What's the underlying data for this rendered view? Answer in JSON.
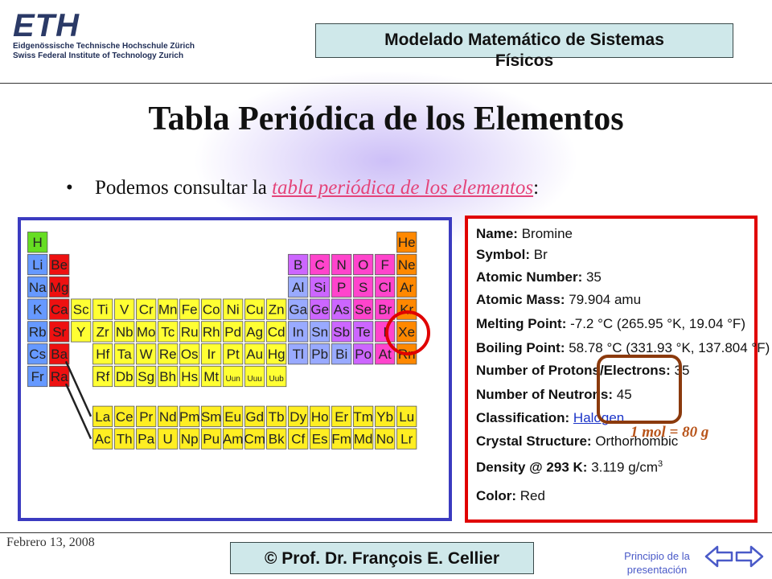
{
  "header": {
    "logo_mark": "ETH",
    "logo_line1": "Eidgenössische Technische Hochschule Zürich",
    "logo_line2": "Swiss Federal Institute of Technology Zurich",
    "course_line1": "Modelado Matemático de Sistemas",
    "course_line2": "Físicos"
  },
  "slide": {
    "title": "Tabla Periódica de los Elementos",
    "bullet_prefix": "Podemos consultar la ",
    "bullet_link": "tabla periódica de los elementos",
    "bullet_suffix": ":"
  },
  "element_info": [
    {
      "label": "Name:",
      "value": "Bromine"
    },
    {
      "label": "Symbol:",
      "value": "Br"
    },
    {
      "label": "Atomic Number:",
      "value": "35"
    },
    {
      "label": "Atomic Mass:",
      "value": "79.904 amu"
    },
    {
      "label": "Melting Point:",
      "value": "-7.2 °C (265.95 °K, 19.04 °F)"
    },
    {
      "label": "Boiling Point:",
      "value": "58.78 °C (331.93 °K, 137.804 °F)"
    },
    {
      "label": "Number of Protons/Electrons:",
      "value": "35"
    },
    {
      "label": "Number of Neutrons:",
      "value": "45"
    },
    {
      "label": "Classification:",
      "value": "Halogen"
    },
    {
      "label": "Crystal Structure:",
      "value": "Orthorhombic"
    },
    {
      "label": "Density @ 293 K:",
      "value": "3.119 g/cm"
    },
    {
      "label": "Color:",
      "value": "Red"
    }
  ],
  "density_exponent": "3",
  "annotation": "1 mol = 80 g",
  "footer": {
    "date": "Febrero 13, 2008",
    "author": "© Prof. Dr. François E. Cellier",
    "start_line1": "Principio de la",
    "start_line2": "presentación"
  },
  "periodic_table": {
    "colors": {
      "h": "#66dd22",
      "alkali": "#6699ff",
      "alkaline": "#ee1111",
      "transition": "#ffff33",
      "metal": "#99aaff",
      "metalloid": "#cc66ff",
      "nonmetal": "#ff44cc",
      "halogen": "#ff44cc",
      "noble": "#ff8800",
      "lanth": "#ffee22",
      "unknown": "#ffff33"
    },
    "rows": [
      [
        [
          "H",
          "h",
          0
        ],
        [
          "He",
          "noble",
          17
        ]
      ],
      [
        [
          "Li",
          "alkali",
          0
        ],
        [
          "Be",
          "alkaline",
          1
        ],
        [
          "B",
          "metalloid",
          12
        ],
        [
          "C",
          "nonmetal",
          13
        ],
        [
          "N",
          "nonmetal",
          14
        ],
        [
          "O",
          "nonmetal",
          15
        ],
        [
          "F",
          "halogen",
          16
        ],
        [
          "Ne",
          "noble",
          17
        ]
      ],
      [
        [
          "Na",
          "alkali",
          0
        ],
        [
          "Mg",
          "alkaline",
          1
        ],
        [
          "Al",
          "metal",
          12
        ],
        [
          "Si",
          "metalloid",
          13
        ],
        [
          "P",
          "nonmetal",
          14
        ],
        [
          "S",
          "nonmetal",
          15
        ],
        [
          "Cl",
          "halogen",
          16
        ],
        [
          "Ar",
          "noble",
          17
        ]
      ],
      [
        [
          "K",
          "alkali",
          0
        ],
        [
          "Ca",
          "alkaline",
          1
        ],
        [
          "Sc",
          "transition",
          2
        ],
        [
          "Ti",
          "transition",
          3
        ],
        [
          "V",
          "transition",
          4
        ],
        [
          "Cr",
          "transition",
          5
        ],
        [
          "Mn",
          "transition",
          6
        ],
        [
          "Fe",
          "transition",
          7
        ],
        [
          "Co",
          "transition",
          8
        ],
        [
          "Ni",
          "transition",
          9
        ],
        [
          "Cu",
          "transition",
          10
        ],
        [
          "Zn",
          "transition",
          11
        ],
        [
          "Ga",
          "metal",
          12
        ],
        [
          "Ge",
          "metalloid",
          13
        ],
        [
          "As",
          "metalloid",
          14
        ],
        [
          "Se",
          "nonmetal",
          15
        ],
        [
          "Br",
          "halogen",
          16
        ],
        [
          "Kr",
          "noble",
          17
        ]
      ],
      [
        [
          "Rb",
          "alkali",
          0
        ],
        [
          "Sr",
          "alkaline",
          1
        ],
        [
          "Y",
          "transition",
          2
        ],
        [
          "Zr",
          "transition",
          3
        ],
        [
          "Nb",
          "transition",
          4
        ],
        [
          "Mo",
          "transition",
          5
        ],
        [
          "Tc",
          "transition",
          6
        ],
        [
          "Ru",
          "transition",
          7
        ],
        [
          "Rh",
          "transition",
          8
        ],
        [
          "Pd",
          "transition",
          9
        ],
        [
          "Ag",
          "transition",
          10
        ],
        [
          "Cd",
          "transition",
          11
        ],
        [
          "In",
          "metal",
          12
        ],
        [
          "Sn",
          "metal",
          13
        ],
        [
          "Sb",
          "metalloid",
          14
        ],
        [
          "Te",
          "metalloid",
          15
        ],
        [
          "I",
          "halogen",
          16
        ],
        [
          "Xe",
          "noble",
          17
        ]
      ],
      [
        [
          "Cs",
          "alkali",
          0
        ],
        [
          "Ba",
          "alkaline",
          1
        ],
        [
          "Hf",
          "transition",
          3
        ],
        [
          "Ta",
          "transition",
          4
        ],
        [
          "W",
          "transition",
          5
        ],
        [
          "Re",
          "transition",
          6
        ],
        [
          "Os",
          "transition",
          7
        ],
        [
          "Ir",
          "transition",
          8
        ],
        [
          "Pt",
          "transition",
          9
        ],
        [
          "Au",
          "transition",
          10
        ],
        [
          "Hg",
          "transition",
          11
        ],
        [
          "Tl",
          "metal",
          12
        ],
        [
          "Pb",
          "metal",
          13
        ],
        [
          "Bi",
          "metal",
          14
        ],
        [
          "Po",
          "metalloid",
          15
        ],
        [
          "At",
          "halogen",
          16
        ],
        [
          "Rn",
          "noble",
          17
        ]
      ],
      [
        [
          "Fr",
          "alkali",
          0
        ],
        [
          "Ra",
          "alkaline",
          1
        ],
        [
          "Rf",
          "transition",
          3
        ],
        [
          "Db",
          "transition",
          4
        ],
        [
          "Sg",
          "transition",
          5
        ],
        [
          "Bh",
          "transition",
          6
        ],
        [
          "Hs",
          "transition",
          7
        ],
        [
          "Mt",
          "transition",
          8
        ],
        [
          "Uun",
          "unknown",
          9
        ],
        [
          "Uuu",
          "unknown",
          10
        ],
        [
          "Uub",
          "unknown",
          11
        ]
      ]
    ],
    "lanthanides": [
      "La",
      "Ce",
      "Pr",
      "Nd",
      "Pm",
      "Sm",
      "Eu",
      "Gd",
      "Tb",
      "Dy",
      "Ho",
      "Er",
      "Tm",
      "Yb",
      "Lu"
    ],
    "actinides": [
      "Ac",
      "Th",
      "Pa",
      "U",
      "Np",
      "Pu",
      "Am",
      "Cm",
      "Bk",
      "Cf",
      "Es",
      "Fm",
      "Md",
      "No",
      "Lr"
    ]
  }
}
